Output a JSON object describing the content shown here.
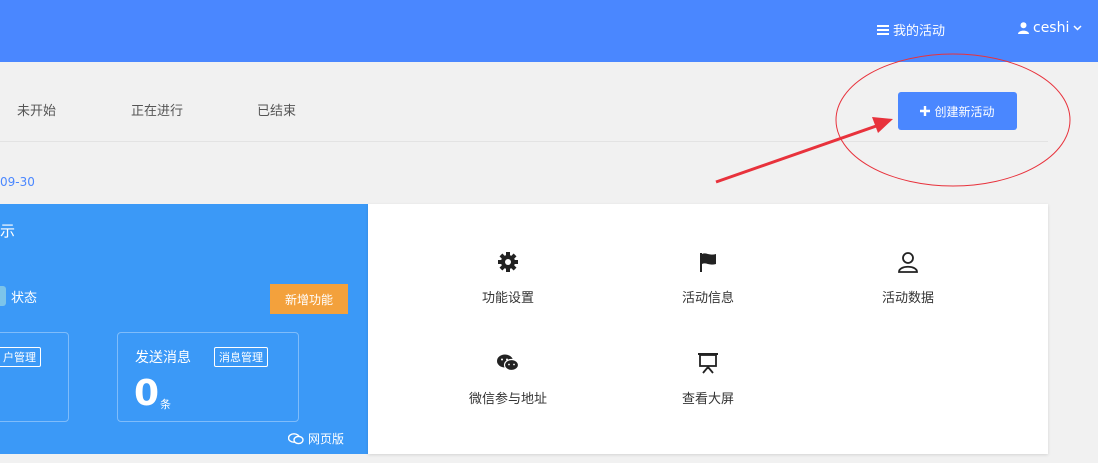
{
  "header": {
    "my_activities": "我的活动",
    "username": "ceshi"
  },
  "tabs": [
    "未开始",
    "正在进行",
    "已结束"
  ],
  "create_button": "创建新活动",
  "date_fragment": "09-30",
  "blue_panel": {
    "title_fragment": "示",
    "status_label": "状态",
    "add_feature": "新增功能",
    "user_manage_fragment": "户管理",
    "send_message": "发送消息",
    "message_manage": "消息管理",
    "message_count": "0",
    "message_unit": "条",
    "web_version": "网页版"
  },
  "features": [
    {
      "label": "功能设置",
      "icon": "gear-icon"
    },
    {
      "label": "活动信息",
      "icon": "flag-icon"
    },
    {
      "label": "活动数据",
      "icon": "user-icon"
    },
    {
      "label": "微信参与地址",
      "icon": "wechat-icon"
    },
    {
      "label": "查看大屏",
      "icon": "presentation-icon"
    }
  ],
  "colors": {
    "header_bg": "#4a87ff",
    "blue_panel": "#3b99f7",
    "add_feature_bg": "#f3a13c",
    "annotation": "#e8323c"
  }
}
